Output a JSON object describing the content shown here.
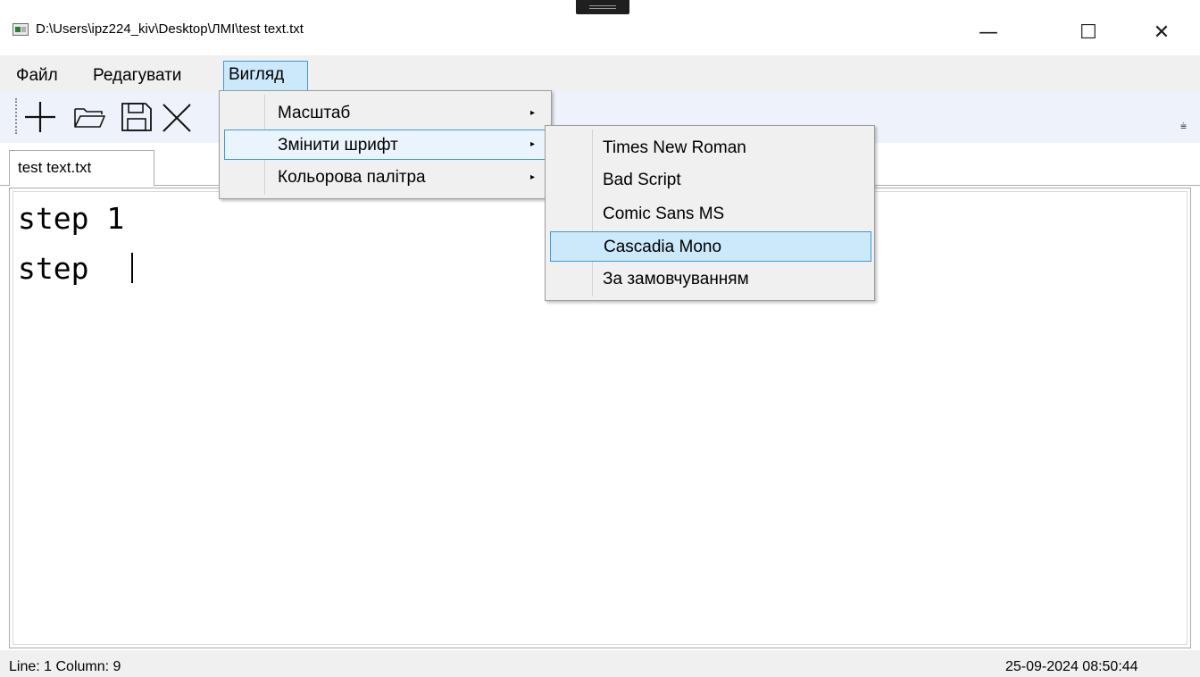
{
  "window": {
    "title": "D:\\Users\\ipz224_kiv\\Desktop\\ЛМІ\\test text.txt",
    "minimize_glyph": "—",
    "maximize_glyph": "☐",
    "close_glyph": "✕"
  },
  "menubar": {
    "file": "Файл",
    "edit": "Редагувати",
    "view": "Вигляд"
  },
  "toolbar": {
    "icons": [
      "new-icon",
      "open-folder-icon",
      "save-icon",
      "close-icon"
    ],
    "overflow_glyph": "⩧"
  },
  "tabs": [
    {
      "label": "test text.txt",
      "active": true
    }
  ],
  "editor": {
    "lines": [
      "step 1",
      "step "
    ]
  },
  "view_menu": {
    "items": [
      {
        "label": "Масштаб",
        "has_submenu": true
      },
      {
        "label": "Змінити шрифт",
        "has_submenu": true,
        "highlighted": true
      },
      {
        "label": "Кольорова палітра",
        "has_submenu": true
      }
    ],
    "arrow_glyph": "▸"
  },
  "font_menu": {
    "items": [
      {
        "label": "Times New Roman"
      },
      {
        "label": "Bad Script"
      },
      {
        "label": "Comic Sans MS"
      },
      {
        "label": "Cascadia Mono",
        "highlighted": true
      },
      {
        "label": "За замовчуванням"
      }
    ]
  },
  "statusbar": {
    "position": "Line:  1 Column:  9",
    "datetime": "25-09-2024 08:50:44"
  },
  "colors": {
    "highlight_bg": "#cce8fb",
    "highlight_border": "#3d9ad8",
    "menu_bg": "#f0f0f0",
    "toolbar_bg": "#eef3fb"
  }
}
